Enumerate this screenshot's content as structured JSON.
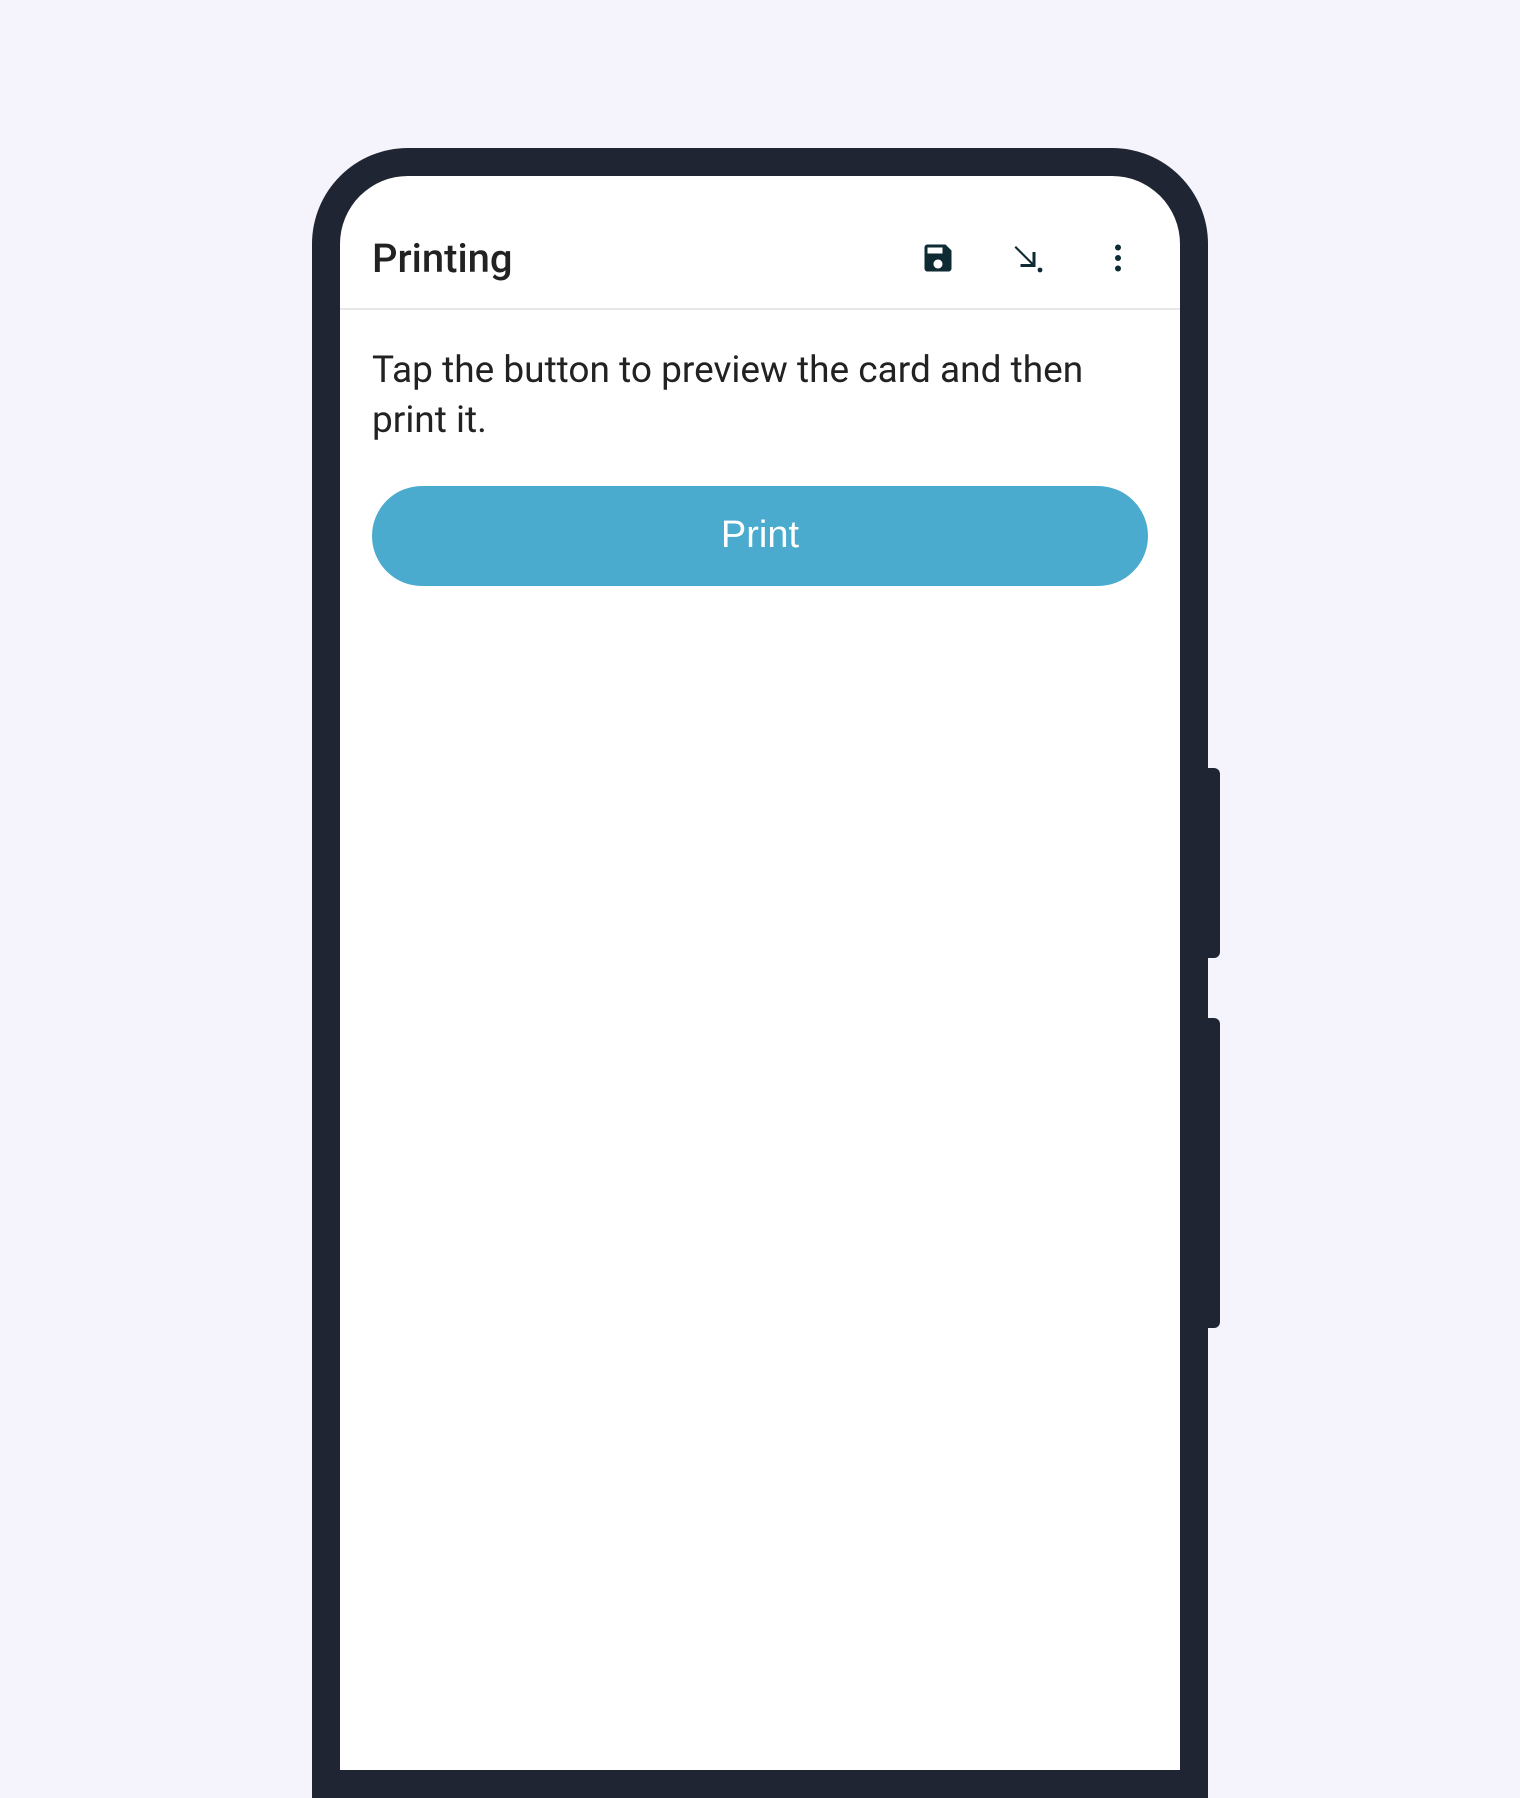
{
  "appbar": {
    "title": "Printing",
    "icons": {
      "save": "save-icon",
      "download": "download-arrow-icon",
      "menu": "more-vert-icon"
    }
  },
  "content": {
    "instruction": "Tap the button to preview the card and then print it.",
    "print_button_label": "Print"
  },
  "colors": {
    "accent": "#4aabce",
    "background": "#f5f3fb",
    "icon": "#0e2a33"
  }
}
